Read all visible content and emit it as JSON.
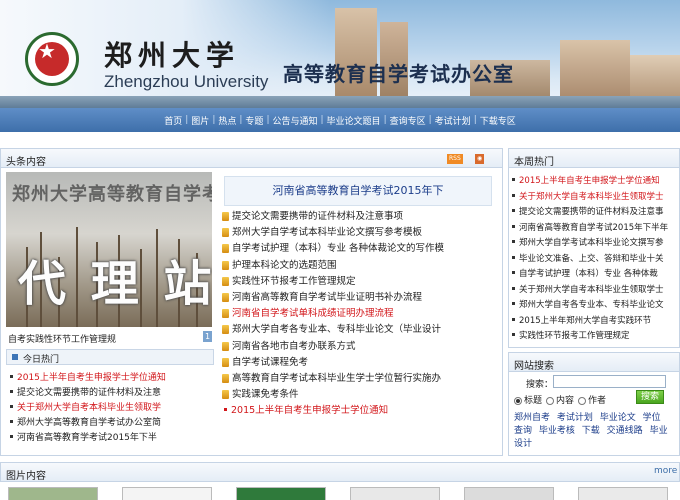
{
  "header": {
    "univ_cn": "郑州大学",
    "univ_en": "Zhengzhou University",
    "office_title": "高等教育自学考试办公室",
    "logo_text": "ZHENGZHOU UNIVERSITY"
  },
  "nav": [
    "首页",
    "图片",
    "热点",
    "专题",
    "公告与通知",
    "毕业论文题目",
    "查询专区",
    "考试计划",
    "下载专区"
  ],
  "headline": {
    "title": "头条内容",
    "rss": "RSS",
    "photo_overlay_top": "郑州大学高等教育自学考试工作",
    "photo_overlay_big": "代 理 站",
    "photo_caption": "自考实践性环节工作管理规",
    "photo_index": "1",
    "today_title": "今日热门",
    "today_items": [
      {
        "text": "2015上半年自考生申报学士学位通知",
        "red": true
      },
      {
        "text": "提交论文需要携带的证件材料及注意",
        "red": false
      },
      {
        "text": "关于郑州大学自考本科毕业生领取学",
        "red": true
      },
      {
        "text": "郑州大学高等教育自学考试办公室简",
        "red": false
      },
      {
        "text": "河南省高等教育学考试2015年下半",
        "red": false
      }
    ],
    "center_title": "河南省高等教育自学考试2015年下",
    "center_items": [
      {
        "text": "提交论文需要携带的证件材料及注意事项",
        "red": false
      },
      {
        "text": "郑州大学自学考试本科毕业论文撰写参考模板",
        "red": false
      },
      {
        "text": "自学考试护理（本科）专业 各种体裁论文的写作模",
        "red": false
      },
      {
        "text": "护理本科论文的选题范围",
        "red": false
      },
      {
        "text": "实践性环节报考工作管理规定",
        "red": false
      },
      {
        "text": "河南省高等教育自学考试毕业证明书补办流程",
        "red": false
      },
      {
        "text": "河南省自学考试单科成绩证明办理流程",
        "red": true
      },
      {
        "text": "郑州大学自考各专业本、专科毕业论文（毕业设计",
        "red": false
      },
      {
        "text": "河南省各地市自考办联系方式",
        "red": false
      },
      {
        "text": "自学考试课程免考",
        "red": false
      },
      {
        "text": "高等教育自学考试本科毕业生学士学位暂行实施办",
        "red": false
      },
      {
        "text": "实践课免考条件",
        "red": false
      },
      {
        "text": "2015上半年自考生申报学士学位通知",
        "red": true,
        "dot": true
      }
    ]
  },
  "weekly_hot": {
    "title": "本周热门",
    "items": [
      {
        "text": "2015上半年自考生申报学士学位通知",
        "red": true
      },
      {
        "text": "关于郑州大学自考本科毕业生领取学士",
        "red": true
      },
      {
        "text": "提交论文需要携带的证件材料及注意事",
        "red": false
      },
      {
        "text": "河南省高等教育自学考试2015年下半年",
        "red": false
      },
      {
        "text": "郑州大学自学考试本科毕业论文撰写参",
        "red": false
      },
      {
        "text": "毕业论文准备、上交、答辩和毕业十关",
        "red": false
      },
      {
        "text": "自学考试护理（本科）专业 各种体裁",
        "red": false
      },
      {
        "text": "关于郑州大学自考本科毕业生领取学士",
        "red": false
      },
      {
        "text": "郑州大学自考各专业本、专科毕业论文",
        "red": false
      },
      {
        "text": "2015上半年郑州大学自考实践环节",
        "red": false
      },
      {
        "text": "实践性环节报考工作管理规定",
        "red": false
      }
    ]
  },
  "search": {
    "title": "网站搜索",
    "label": "搜索：",
    "value": "",
    "options": [
      "标题",
      "内容",
      "作者"
    ],
    "selected": "标题",
    "button": "搜索",
    "links": [
      "郑州自考",
      "考试计划",
      "毕业论文",
      "学位",
      "查询",
      "毕业考核",
      "下载",
      "交通线路",
      "毕业设计"
    ]
  },
  "pictures": {
    "title": "图片内容",
    "more": "more"
  }
}
